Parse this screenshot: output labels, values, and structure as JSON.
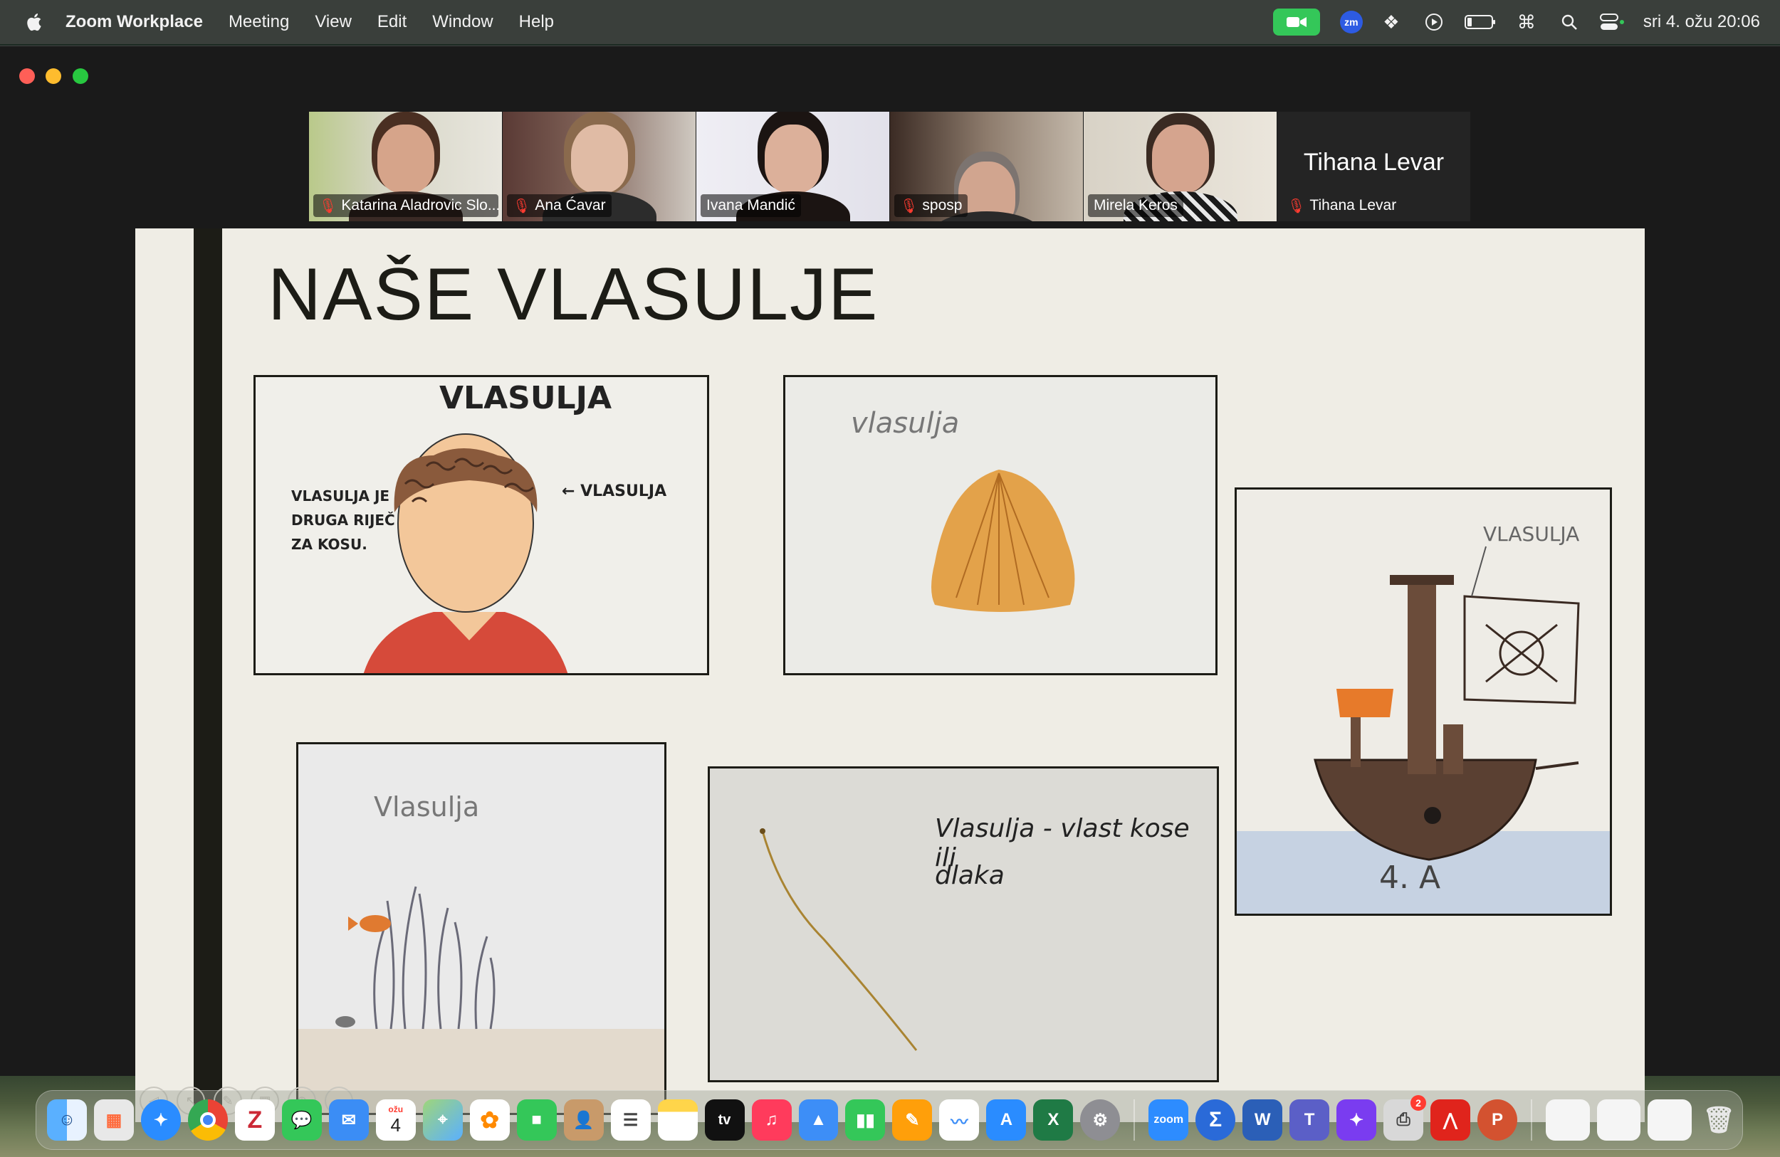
{
  "menubar": {
    "app_name": "Zoom Workplace",
    "menus": [
      "Meeting",
      "View",
      "Edit",
      "Window",
      "Help"
    ],
    "clock": "sri 4. ožu 20:06",
    "zm_label": "zm"
  },
  "participants": [
    {
      "name": "Katarina Aladrovic Slo...",
      "muted": true
    },
    {
      "name": "Ana Ćavar",
      "muted": true
    },
    {
      "name": "Ivana Mandić",
      "muted": false,
      "active": true
    },
    {
      "name": "sposp",
      "muted": true
    },
    {
      "name": "Mirela Keros",
      "muted": false
    },
    {
      "name": "Tihana Levar",
      "muted": true,
      "no_video": true,
      "display_name": "Tihana Levar"
    }
  ],
  "slide": {
    "title": "NAŠE VLASULJE",
    "pictures": [
      {
        "heading": "VLASULJA",
        "text_left": "VLASULJA JE DRUGA RIJEČ ZA KOSU.",
        "arrow_label": "← VLASULJA"
      },
      {
        "heading": "vlasulja"
      },
      {
        "heading": "VLASULJA",
        "footer": "4. A"
      },
      {
        "heading": "Vlasulja"
      },
      {
        "line1": "Vlasulja - vlast kose ili",
        "line2": "dlaka"
      }
    ]
  },
  "dock": {
    "calendar_month": "ožu",
    "calendar_day": "4",
    "zoom_label": "zoom",
    "tv_label": "tv",
    "printer_badge": "2"
  }
}
